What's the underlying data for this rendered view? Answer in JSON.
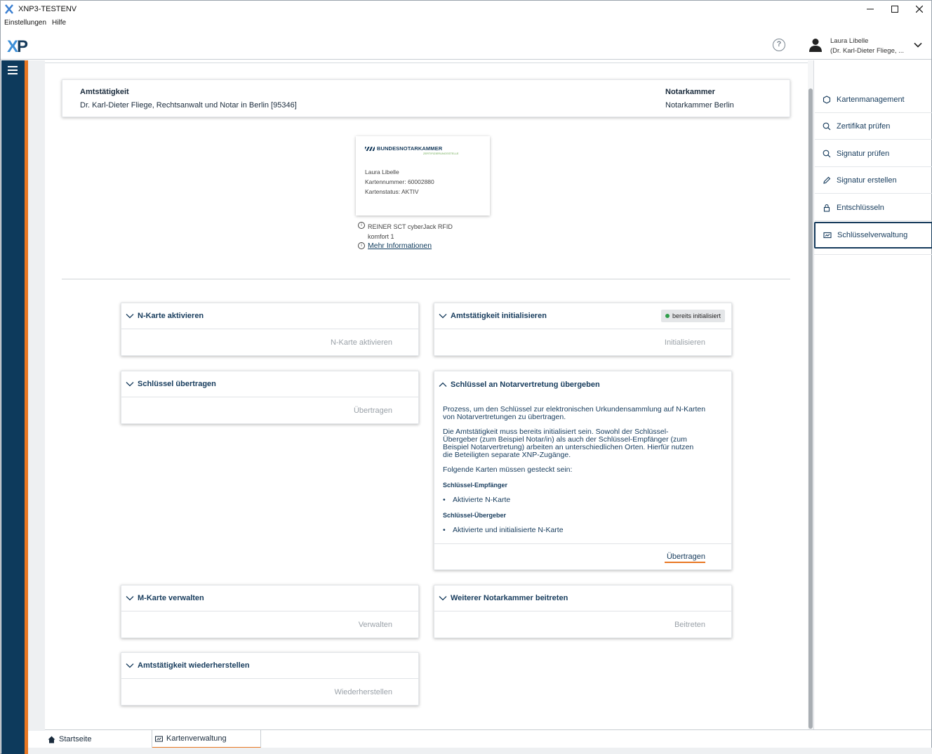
{
  "window": {
    "title": "XNP3-TESTENV",
    "minimize": "—",
    "maximize": "☐",
    "close": "✕"
  },
  "menu": {
    "items": [
      "Einstellungen",
      "Hilfe"
    ]
  },
  "header": {
    "logo_x": "X",
    "logo_p": "P",
    "help": "?",
    "user_line1": "Laura Libelle",
    "user_line2": "(Dr. Karl-Dieter Fliege, ..."
  },
  "amt": {
    "label": "Amtstätigkeit",
    "value": "Dr. Karl-Dieter Fliege, Rechtsanwalt und Notar in Berlin [95346]",
    "nk_label": "Notarkammer",
    "nk_value": "Notarkammer Berlin"
  },
  "card": {
    "org": "BUNDESNOTARKAMMER",
    "org_sub": "ZERTIFIZIERUNGSSTELLE",
    "holder": "Laura Libelle",
    "number": "Kartennummer: 60002880",
    "status": "Kartenstatus: AKTIV"
  },
  "reader": {
    "line1": "REINER SCT cyberJack RFID",
    "line2": "komfort 1",
    "more": "Mehr Informationen"
  },
  "panels": {
    "nkarte": {
      "title": "N-Karte aktivieren",
      "button": "N-Karte aktivieren"
    },
    "init": {
      "title": "Amtstätigkeit initialisieren",
      "badge": "bereits initialisiert",
      "button": "Initialisieren"
    },
    "uebertragen": {
      "title": "Schlüssel übertragen",
      "button": "Übertragen"
    },
    "notarvertretung": {
      "title": "Schlüssel an Notarvertretung übergeben",
      "p1a": "Prozess, um den Schlüssel zur elektronischen Urkundensammlung auf N-Karten",
      "p1b": "von Notarvertretungen zu übertragen.",
      "p2a": "Die Amtstätigkeit muss bereits initialisiert sein. Sowohl der Schlüssel-",
      "p2b": "Übergeber (zum Beispiel Notar/in) als auch der Schlüssel-Empfänger (zum",
      "p2c": "Beispiel Notarvertretung) arbeiten an unterschiedlichen Orten. Hierfür nutzen",
      "p2d": "die Beteiligten separate XNP-Zugänge.",
      "p3": "Folgende Karten müssen gesteckt sein:",
      "h1": "Schlüssel-Empfänger",
      "b1": "Aktivierte N-Karte",
      "h2": "Schlüssel-Übergeber",
      "b2": "Aktivierte und initialisierte N-Karte",
      "button": "Übertragen"
    },
    "mkarte": {
      "title": "M-Karte verwalten",
      "button": "Verwalten"
    },
    "weitere": {
      "title": "Weiterer Notarkammer beitreten",
      "button": "Beitreten"
    },
    "wieder": {
      "title": "Amtstätigkeit wiederherstellen",
      "button": "Wiederherstellen"
    }
  },
  "rightnav": {
    "items": [
      "Kartenmanagement",
      "Zertifikat prüfen",
      "Signatur prüfen",
      "Signatur erstellen",
      "Entschlüsseln",
      "Schlüsselverwaltung"
    ]
  },
  "tabs": {
    "home": "Startseite",
    "karten": "Kartenverwaltung"
  }
}
